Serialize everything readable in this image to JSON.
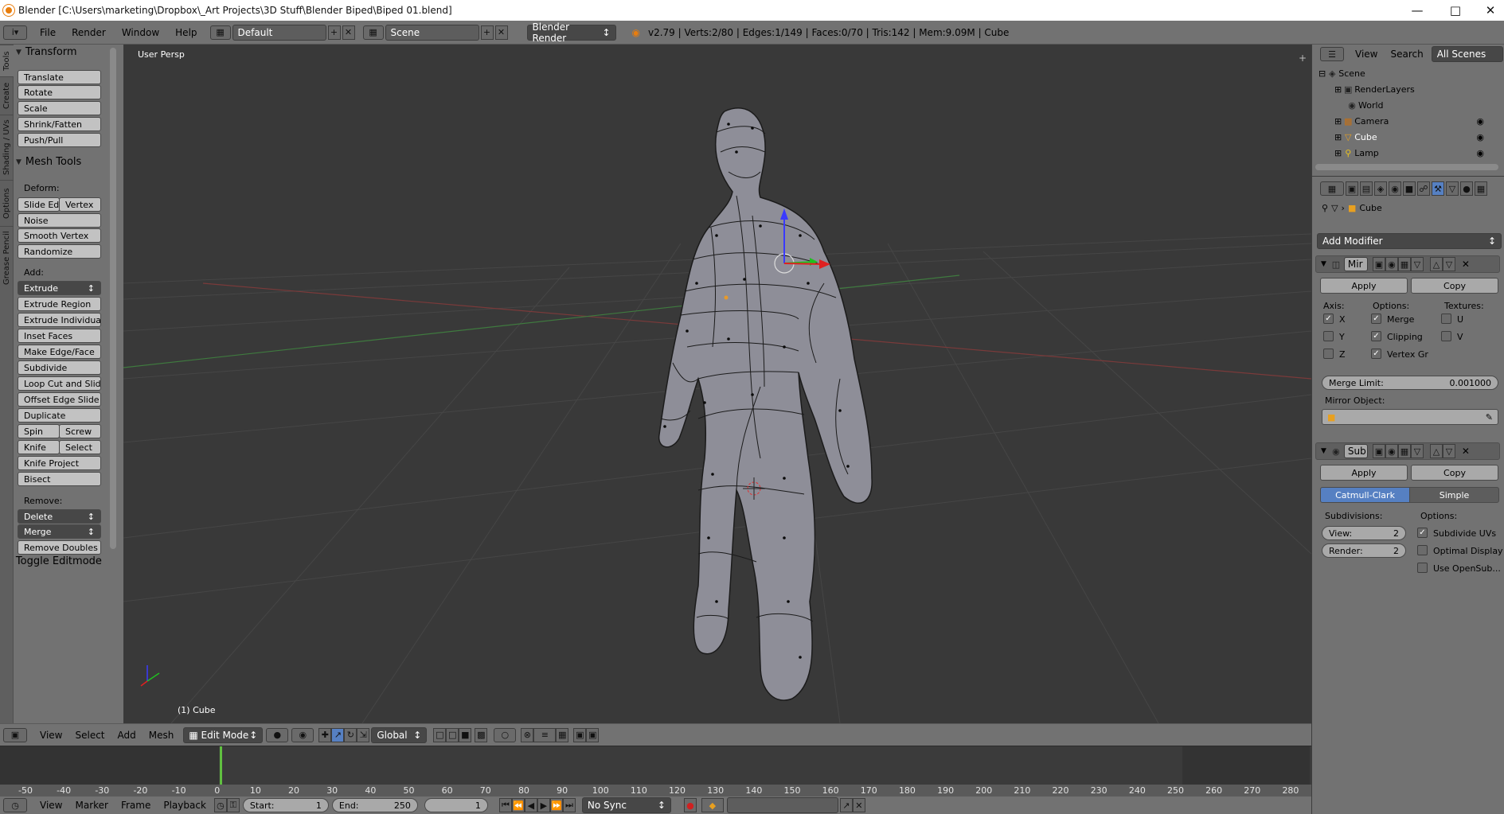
{
  "title": "Blender  [C:\\Users\\marketing\\Dropbox\\_Art Projects\\3D Stuff\\Blender Biped\\Biped 01.blend]",
  "menu": [
    "File",
    "Render",
    "Window",
    "Help"
  ],
  "layout_name": "Default",
  "scene_name": "Scene",
  "engine": "Blender Render",
  "stats": "v2.79 | Verts:2/80 | Edges:1/149 | Faces:0/70 | Tris:142 | Mem:9.09M | Cube",
  "tabs": [
    "Tools",
    "Create",
    "Shading / UVs",
    "Options",
    "Grease Pencil"
  ],
  "transform": {
    "title": "Transform",
    "buttons": [
      "Translate",
      "Rotate",
      "Scale",
      "Shrink/Fatten",
      "Push/Pull"
    ]
  },
  "mesh_tools": {
    "title": "Mesh Tools",
    "deform_label": "Deform:",
    "slide_edge": "Slide Ed",
    "vertex": "Vertex",
    "noise": "Noise",
    "smooth_vertex": "Smooth Vertex",
    "randomize": "Randomize",
    "add_label": "Add:",
    "extrude": "Extrude",
    "extrude_region": "Extrude Region",
    "extrude_individual": "Extrude Individual",
    "inset_faces": "Inset Faces",
    "make_edge_face": "Make Edge/Face",
    "subdivide": "Subdivide",
    "loop_cut": "Loop Cut and Slide",
    "offset_edge_slide": "Offset Edge Slide",
    "duplicate": "Duplicate",
    "spin": "Spin",
    "screw": "Screw",
    "knife": "Knife",
    "select": "Select",
    "knife_project": "Knife Project",
    "bisect": "Bisect",
    "remove_label": "Remove:",
    "delete": "Delete",
    "merge": "Merge",
    "remove_doubles": "Remove Doubles"
  },
  "toggle_editmode": "Toggle Editmode",
  "viewport": {
    "view_label": "User Persp",
    "object_label": "(1) Cube"
  },
  "view_header": {
    "menu": [
      "View",
      "Select",
      "Add",
      "Mesh"
    ],
    "mode": "Edit Mode",
    "orientation": "Global"
  },
  "timeline": {
    "ticks": [
      "-50",
      "-40",
      "-30",
      "-20",
      "-10",
      "0",
      "10",
      "20",
      "30",
      "40",
      "50",
      "60",
      "70",
      "80",
      "90",
      "100",
      "110",
      "120",
      "130",
      "140",
      "150",
      "160",
      "170",
      "180",
      "190",
      "200",
      "210",
      "220",
      "230",
      "240",
      "250",
      "260",
      "270",
      "280"
    ]
  },
  "timeline_header": {
    "menu": [
      "View",
      "Marker",
      "Frame",
      "Playback"
    ],
    "start_label": "Start:",
    "start": "1",
    "end_label": "End:",
    "end": "250",
    "current": "1",
    "sync": "No Sync"
  },
  "outliner": {
    "menu": [
      "View",
      "Search"
    ],
    "filter": "All Scenes",
    "items": [
      "Scene",
      "RenderLayers",
      "World",
      "Camera",
      "Cube",
      "Lamp"
    ]
  },
  "props": {
    "object": "Cube",
    "add_modifier": "Add Modifier",
    "mirror": {
      "name": "Mir",
      "apply": "Apply",
      "copy": "Copy",
      "axis_label": "Axis:",
      "options_label": "Options:",
      "textures_label": "Textures:",
      "axes": [
        "X",
        "Y",
        "Z"
      ],
      "options": [
        "Merge",
        "Clipping",
        "Vertex Gr"
      ],
      "textures": [
        "U",
        "V"
      ],
      "merge_limit_label": "Merge Limit:",
      "merge_limit": "0.001000",
      "mirror_object_label": "Mirror Object:"
    },
    "subsurf": {
      "name": "Sub",
      "apply": "Apply",
      "copy": "Copy",
      "catmull": "Catmull-Clark",
      "simple": "Simple",
      "subdivisions_label": "Subdivisions:",
      "options_label": "Options:",
      "view_label": "View:",
      "view": "2",
      "render_label": "Render:",
      "render": "2",
      "options": [
        "Subdivide UVs",
        "Optimal Display",
        "Use OpenSub..."
      ]
    }
  },
  "colors": {
    "accent": "#5680c2",
    "viewport_bg": "#393939",
    "panel": "#727272"
  }
}
